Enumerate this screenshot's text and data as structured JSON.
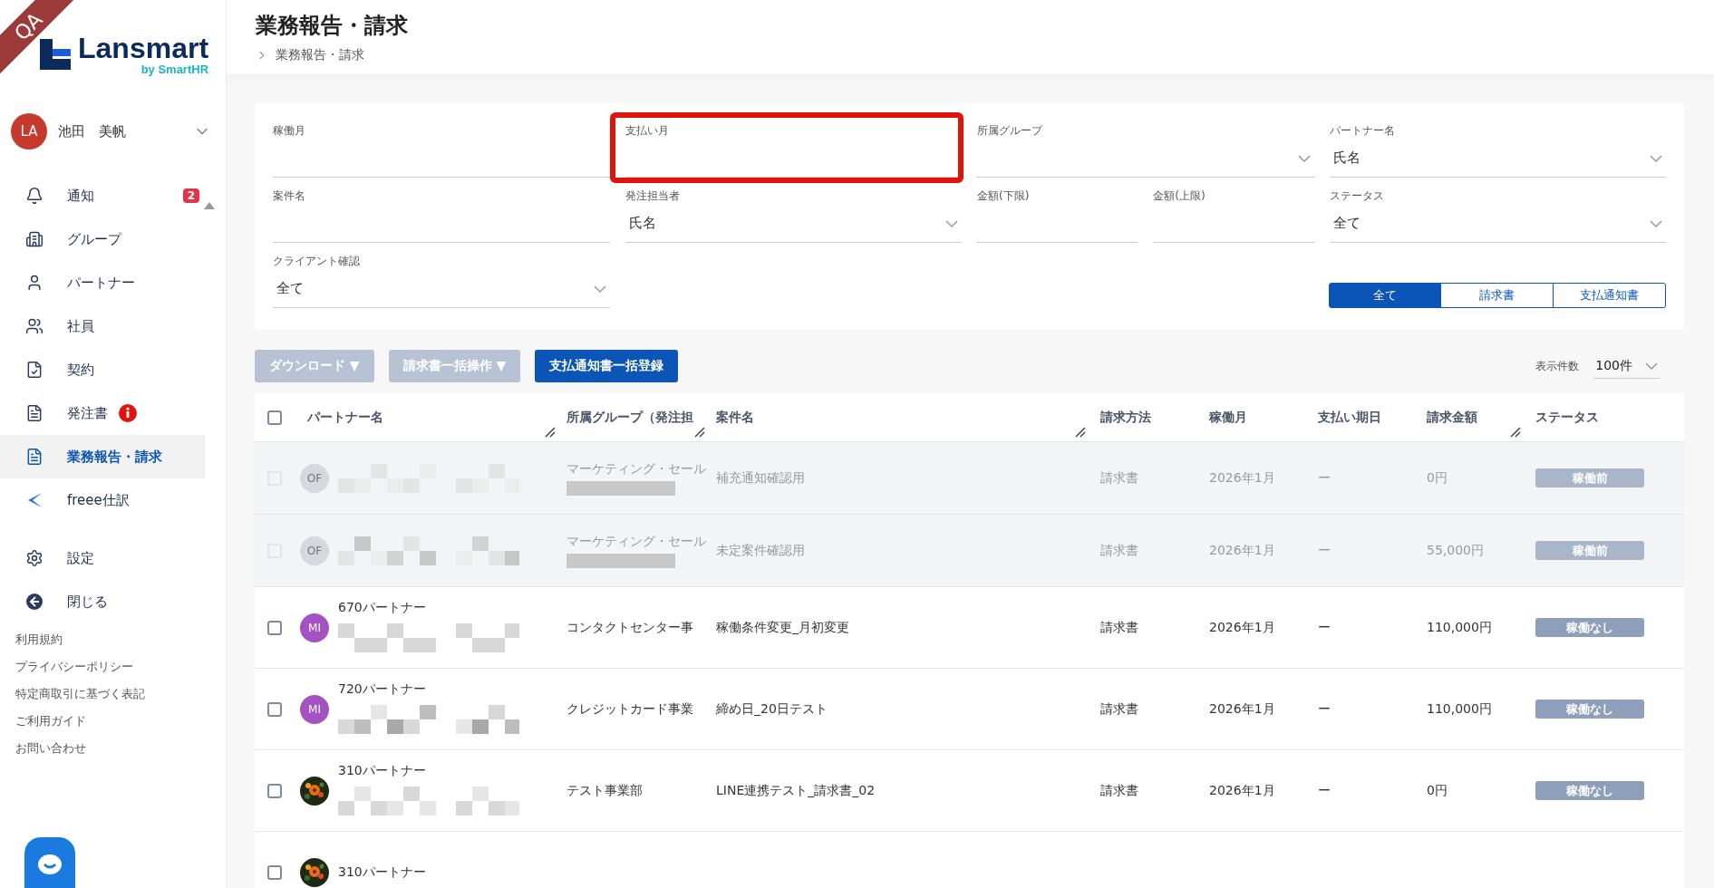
{
  "environment_badge": "QA",
  "logo": {
    "name": "Lansmart",
    "byline": "by SmartHR"
  },
  "user": {
    "initials": "LA",
    "name": "池田　美帆"
  },
  "sidebar": {
    "items": [
      {
        "label": "通知",
        "badge": "2",
        "alert": false,
        "selected": false
      },
      {
        "label": "グループ",
        "alert": false,
        "selected": false
      },
      {
        "label": "パートナー",
        "alert": false,
        "selected": false
      },
      {
        "label": "社員",
        "alert": false,
        "selected": false
      },
      {
        "label": "契約",
        "alert": false,
        "selected": false
      },
      {
        "label": "発注書",
        "alert": true,
        "selected": false
      },
      {
        "label": "業務報告・請求",
        "alert": false,
        "selected": true
      },
      {
        "label": "freee仕訳",
        "alert": false,
        "selected": false
      },
      {
        "label": "設定",
        "alert": false,
        "selected": false
      },
      {
        "label": "閉じる",
        "alert": false,
        "selected": false
      }
    ],
    "links": [
      "利用規約",
      "プライバシーポリシー",
      "特定商取引に基づく表記",
      "ご利用ガイド",
      "お問い合わせ"
    ]
  },
  "page": {
    "title": "業務報告・請求",
    "breadcrumb": "業務報告・請求"
  },
  "filters": [
    {
      "label": "稼働月",
      "kind": "text",
      "highlighted": false
    },
    {
      "label": "支払い月",
      "kind": "text",
      "highlighted": true
    },
    {
      "label": "所属グループ",
      "kind": "select",
      "highlighted": false
    },
    {
      "label": "パートナー名",
      "kind": "select",
      "value": "氏名",
      "highlighted": false
    },
    {
      "label": "案件名",
      "kind": "text",
      "highlighted": false
    },
    {
      "label": "発注担当者",
      "kind": "select",
      "value": "氏名",
      "highlighted": false
    },
    {
      "label": "金額(下限)",
      "kind": "text",
      "highlighted": false
    },
    {
      "label": "金額(上限)",
      "kind": "text",
      "highlighted": false
    },
    {
      "label": "ステータス",
      "kind": "select",
      "value": "全て",
      "highlighted": false
    },
    {
      "label": "クライアント確認",
      "kind": "select",
      "value": "全て",
      "highlighted": false
    }
  ],
  "doc_type_tabs": [
    {
      "label": "全て",
      "selected": true
    },
    {
      "label": "請求書",
      "selected": false
    },
    {
      "label": "支払通知書",
      "selected": false
    }
  ],
  "actions": [
    {
      "label": "ダウンロード ▼",
      "disabled": true
    },
    {
      "label": "請求書一括操作 ▼",
      "disabled": true
    },
    {
      "label": "支払通知書一括登録",
      "disabled": false
    }
  ],
  "page_size": {
    "label": "表示件数",
    "value": "100件"
  },
  "table": {
    "select_all_checked": false,
    "columns": [
      "パートナー名",
      "所属グループ（発注担",
      "案件名",
      "請求方法",
      "稼働月",
      "支払い期日",
      "請求金額",
      "ステータス"
    ],
    "rows": [
      {
        "disabled": true,
        "checked": false,
        "avatar": {
          "kind": "initials",
          "text": "OF",
          "color": "#d5d8dc"
        },
        "group": "マーケティング・セール",
        "project": "補充通知確認用",
        "method": "請求書",
        "month": "2026年1月",
        "due": "ー",
        "amount": "0円",
        "status": "稼働前"
      },
      {
        "disabled": true,
        "checked": false,
        "avatar": {
          "kind": "initials",
          "text": "OF",
          "color": "#d5d8dc"
        },
        "group": "マーケティング・セール",
        "project": "未定案件確認用",
        "method": "請求書",
        "month": "2026年1月",
        "due": "ー",
        "amount": "55,000円",
        "status": "稼働前"
      },
      {
        "disabled": false,
        "checked": false,
        "avatar": {
          "kind": "initials",
          "text": "MI",
          "color": "#a452c3"
        },
        "partner": "670パートナー",
        "group": "コンタクトセンター事",
        "project": "稼働条件変更_月初変更",
        "method": "請求書",
        "month": "2026年1月",
        "due": "ー",
        "amount": "110,000円",
        "status": "稼働なし"
      },
      {
        "disabled": false,
        "checked": false,
        "avatar": {
          "kind": "initials",
          "text": "MI",
          "color": "#a452c3"
        },
        "partner": "720パートナー",
        "group": "クレジットカード事業",
        "project": "締め日_20日テスト",
        "method": "請求書",
        "month": "2026年1月",
        "due": "ー",
        "amount": "110,000円",
        "status": "稼働なし"
      },
      {
        "disabled": false,
        "checked": false,
        "partner": "310パートナー",
        "group": "テスト事業部",
        "project": "LINE連携テスト_請求書_02",
        "method": "請求書",
        "month": "2026年1月",
        "due": "ー",
        "amount": "0円",
        "status": "稼働なし"
      },
      {
        "disabled": false,
        "checked": false,
        "partner": "310パートナー"
      }
    ]
  }
}
